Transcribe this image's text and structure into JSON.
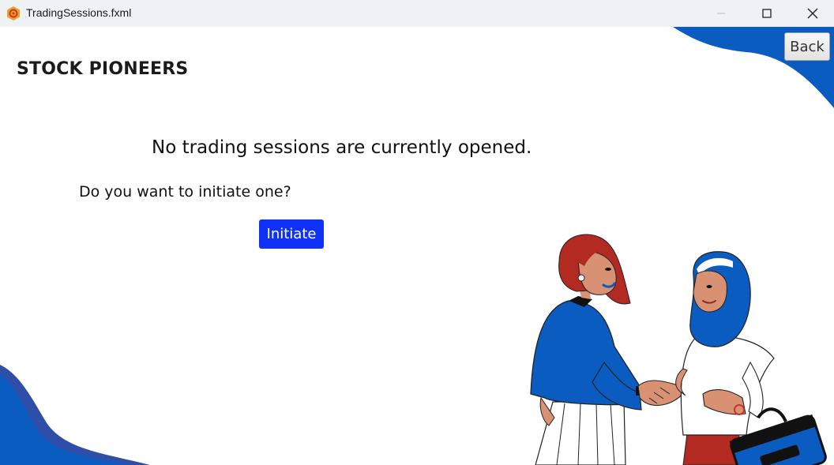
{
  "window": {
    "title": "TradingSessions.fxml",
    "icon": "app-logo-icon",
    "controls": [
      "minimize-icon",
      "maximize-icon",
      "close-icon"
    ]
  },
  "header": {
    "brand": "STOCK PIONEERS",
    "back_label": "Back"
  },
  "main": {
    "headline": "No trading sessions are currently opened.",
    "question": "Do you want to initiate one?",
    "initiate_label": "Initiate"
  },
  "colors": {
    "accent_blue": "#1032f7",
    "decor_blue": "#0b5cc0",
    "titlebar_bg": "#eef2f7"
  }
}
